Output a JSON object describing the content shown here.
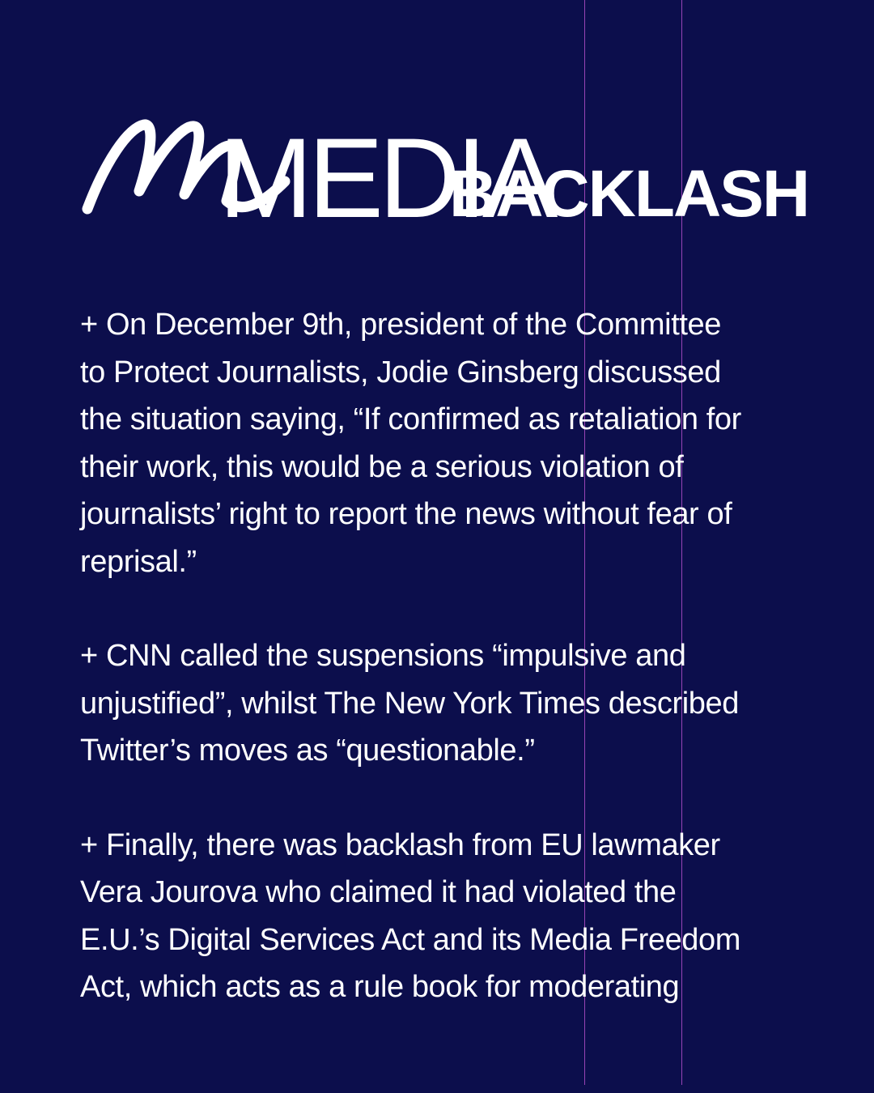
{
  "header": {
    "title_main": "MEDIA",
    "title_sub": "BACKLASH"
  },
  "paragraphs": [
    "+ On December 9th, president of the Committee\nto Protect Journalists, Jodie Ginsberg discussed\nthe situation saying, “If confirmed as retaliation for\ntheir work, this would be a serious violation of\njournalists’ right to report the news without fear of\nreprisal.”",
    "+ CNN called the suspensions “impulsive and\nunjustified”, whilst The New York Times described\nTwitter’s moves as “questionable.”",
    "+ Finally, there was backlash from EU lawmaker\nVera Jourova who claimed it had violated the\nE.U.’s Digital Services Act and its Media Freedom\nAct, which acts as a rule book for moderating"
  ],
  "colors": {
    "background": "#0c0e4c",
    "text": "#ffffff",
    "guide_lines": "#b04cc8"
  }
}
